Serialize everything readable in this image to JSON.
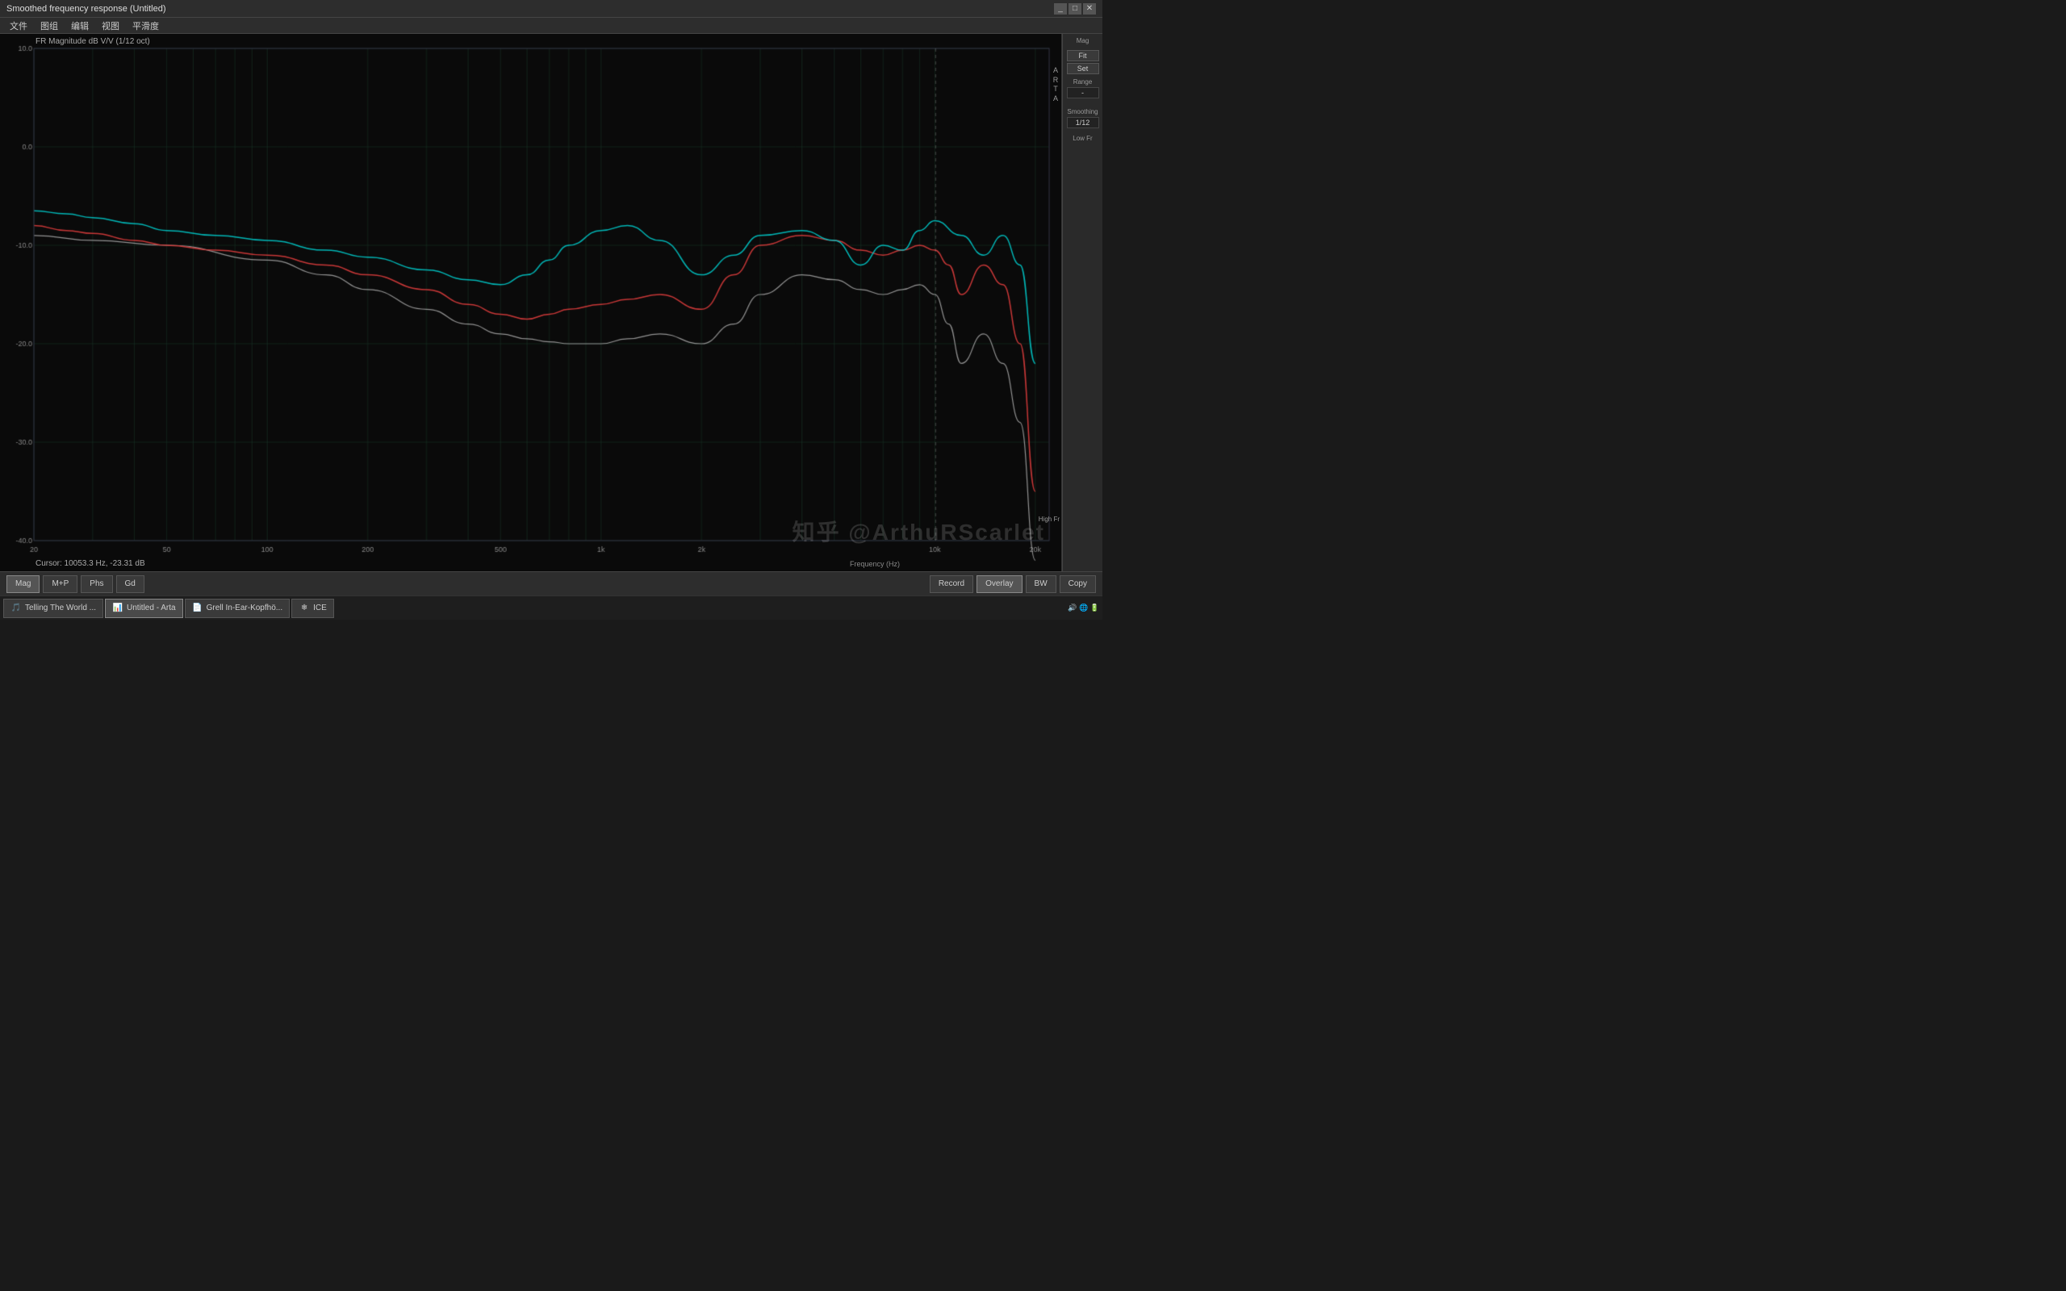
{
  "window": {
    "title": "Smoothed frequency response (Untitled)"
  },
  "menu": {
    "items": [
      "文件",
      "图组",
      "编辑",
      "视图",
      "平滑度"
    ]
  },
  "chart": {
    "title": "FR Magnitude dB V/V (1/12 oct)",
    "y_labels": [
      {
        "value": "10.0",
        "pct": 2
      },
      {
        "value": "0.0",
        "pct": 24
      },
      {
        "value": "-10.0",
        "pct": 46
      },
      {
        "value": "-20.0",
        "pct": 68
      },
      {
        "value": "-30.0",
        "pct": 80
      },
      {
        "value": "-40.0",
        "pct": 96
      }
    ],
    "x_labels": [
      {
        "value": "20",
        "pct": 1
      },
      {
        "value": "50",
        "pct": 12
      },
      {
        "value": "100",
        "pct": 22
      },
      {
        "value": "200",
        "pct": 36
      },
      {
        "value": "500",
        "pct": 56
      },
      {
        "value": "1k",
        "pct": 70
      },
      {
        "value": "2k",
        "pct": 80
      },
      {
        "value": "20k",
        "pct": 99
      }
    ],
    "cursor_info": "Cursor: 10053.3 Hz, -23.31 dB",
    "watermark": "知乎 @ArthuRScarlet",
    "freq_label": "Frequency (Hz)",
    "high_fr_label": "High Fr"
  },
  "right_panel": {
    "mag_label": "Mag",
    "fit_label": "Fit",
    "set_label": "Set",
    "range_label": "Range",
    "smoothing_label": "Smoothing",
    "low_fr_label": "Low Fr",
    "smoothing_value": "1/12",
    "arta_label": "A\nR\nT\nA"
  },
  "bottom_toolbar": {
    "record_label": "Record",
    "overlay_label": "Overlay",
    "bw_label": "BW",
    "copy_label": "Copy"
  },
  "mode_buttons": {
    "mag": "Mag",
    "mhp": "M+P",
    "phs": "Phs",
    "gd": "Gd"
  },
  "taskbar": {
    "items": [
      {
        "label": "Telling The World ...",
        "icon": "🎵",
        "active": false
      },
      {
        "label": "Untitled - Arta",
        "icon": "📊",
        "active": true
      },
      {
        "label": "Grell In-Ear-Kopfhö...",
        "icon": "📄",
        "active": false
      },
      {
        "label": "ICE",
        "icon": "❄",
        "active": false
      }
    ],
    "system_icons": [
      "🔊",
      "🌐",
      "🔋"
    ]
  }
}
